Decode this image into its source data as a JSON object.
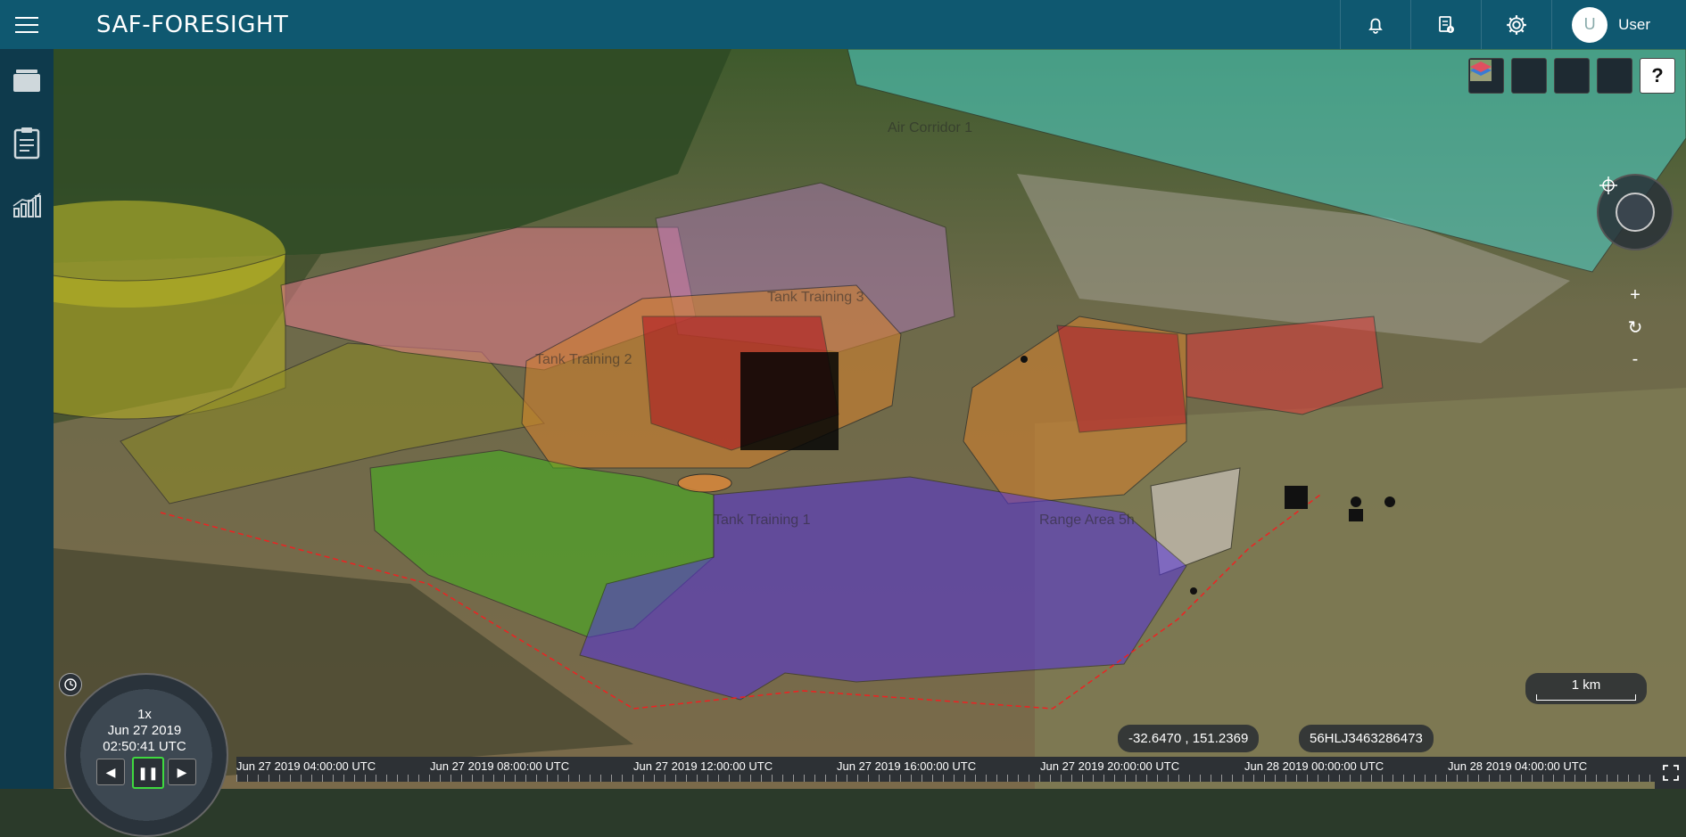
{
  "app": {
    "title": "SAF-FORESIGHT"
  },
  "header": {
    "user_initial": "U",
    "user_name": "User"
  },
  "map": {
    "labels": [
      "Air Corridor 1",
      "Tank Training 3",
      "Tank Training 1",
      "Tank Training 2",
      "Range Area 5h"
    ],
    "coordinates": "-32.6470 , 151.2369",
    "grid_reference": "56HLJ3463286473",
    "scale": "1 km",
    "zoom_in": "+",
    "zoom_reset": "↻",
    "zoom_out": "-"
  },
  "animation": {
    "speed": "1x",
    "date": "Jun 27 2019",
    "time": "02:50:41 UTC"
  },
  "timeline": {
    "ticks": [
      "Jun 27 2019 04:00:00 UTC",
      "Jun 27 2019 08:00:00 UTC",
      "Jun 27 2019 12:00:00 UTC",
      "Jun 27 2019 16:00:00 UTC",
      "Jun 27 2019 20:00:00 UTC",
      "Jun 28 2019 00:00:00 UTC",
      "Jun 28 2019 04:00:00 UTC"
    ]
  },
  "colors": {
    "header": "#0f5870",
    "sidebar": "#0e3a4c",
    "corridor": "#4fd6cf"
  }
}
